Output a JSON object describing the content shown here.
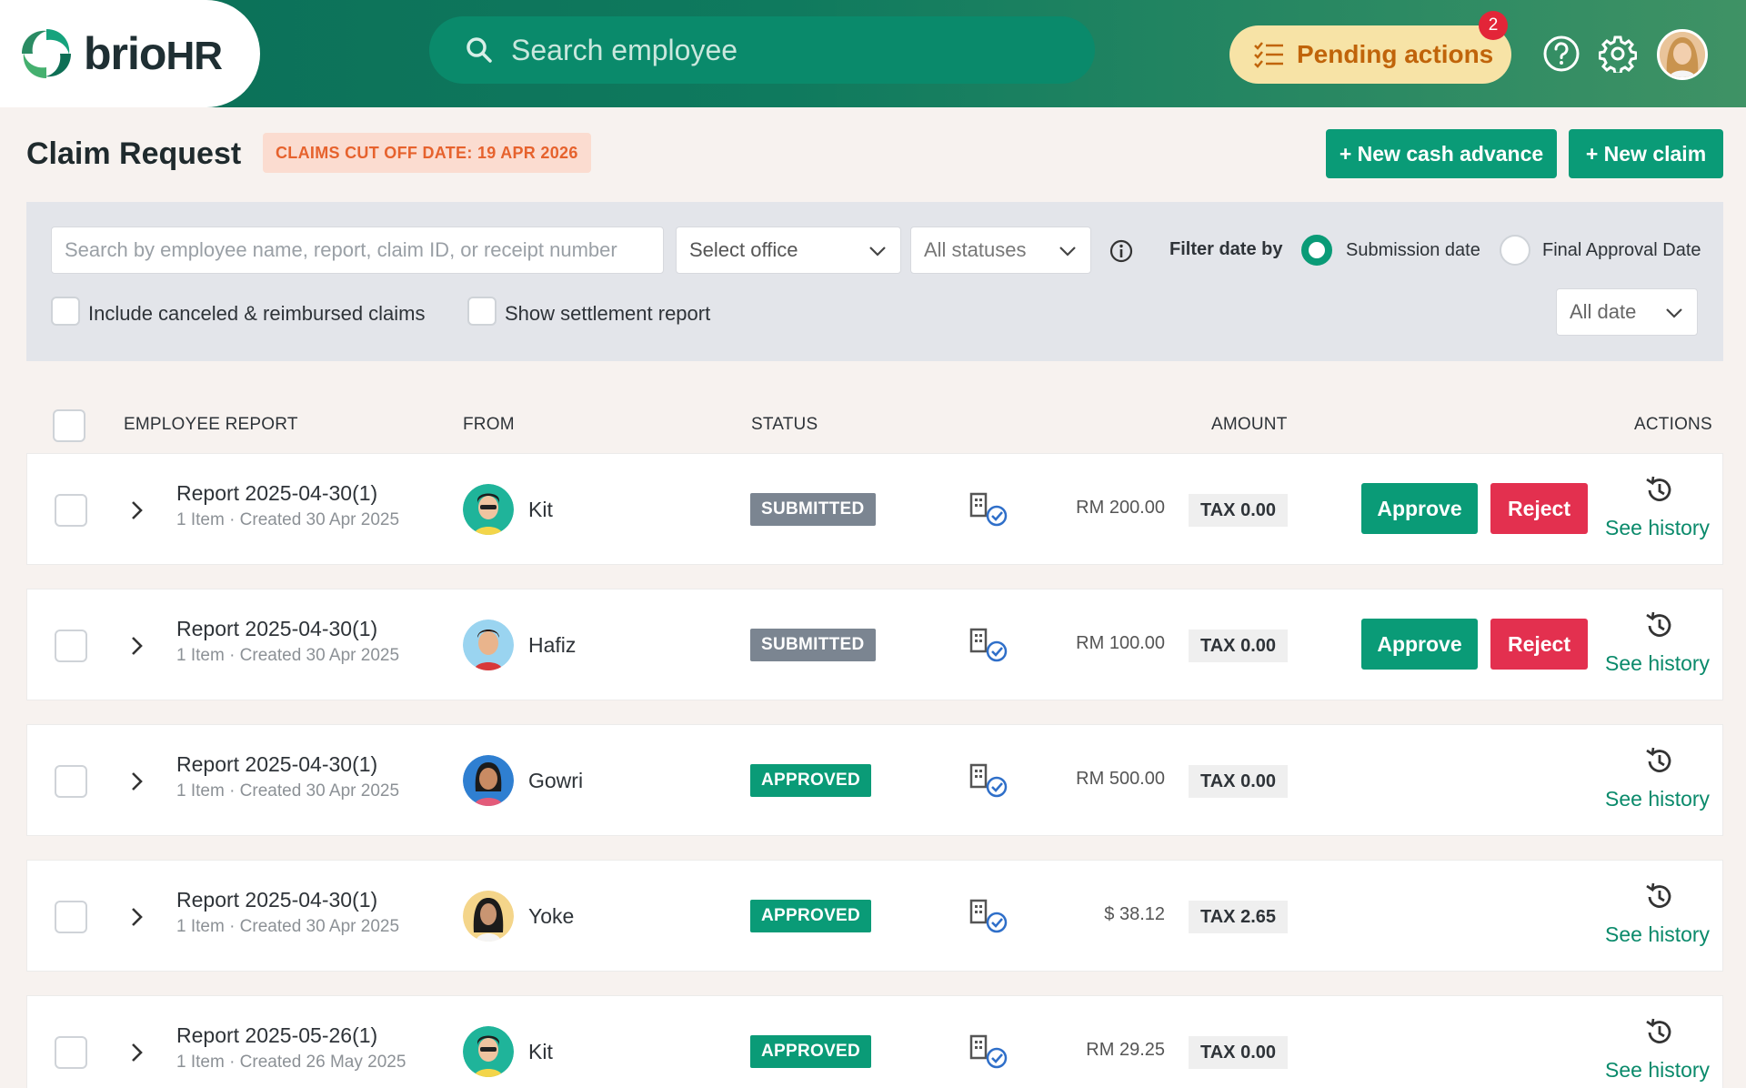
{
  "header": {
    "logo_text": "brio",
    "logo_suffix": "HR",
    "search_placeholder": "Search employee",
    "pending_label": "Pending actions",
    "pending_count": "2"
  },
  "page": {
    "title": "Claim Request",
    "cutoff_label": "CLAIMS CUT OFF DATE: 19 APR 2026",
    "new_cash_advance": "+ New cash advance",
    "new_claim": "+ New claim"
  },
  "filters": {
    "search_placeholder": "Search by employee name, report, claim ID, or receipt number",
    "office": "Select office",
    "status": "All statuses",
    "filter_date_by": "Filter date by",
    "submission_date": "Submission date",
    "final_approval_date": "Final Approval Date",
    "include_canceled": "Include canceled & reimbursed claims",
    "show_settlement": "Show settlement report",
    "date_range": "All date"
  },
  "table": {
    "headers": {
      "employee_report": "EMPLOYEE REPORT",
      "from": "FROM",
      "status": "STATUS",
      "amount": "AMOUNT",
      "actions": "ACTIONS"
    },
    "approve_label": "Approve",
    "reject_label": "Reject",
    "history_label": "See history",
    "rows": [
      {
        "report": "Report 2025-04-30(1)",
        "meta": "1 Item · Created 30 Apr 2025",
        "name": "Kit",
        "status": "SUBMITTED",
        "amount": "RM 200.00",
        "tax": "TAX 0.00"
      },
      {
        "report": "Report 2025-04-30(1)",
        "meta": "1 Item · Created 30 Apr 2025",
        "name": "Hafiz",
        "status": "SUBMITTED",
        "amount": "RM 100.00",
        "tax": "TAX 0.00"
      },
      {
        "report": "Report 2025-04-30(1)",
        "meta": "1 Item · Created 30 Apr 2025",
        "name": "Gowri",
        "status": "APPROVED",
        "amount": "RM 500.00",
        "tax": "TAX 0.00"
      },
      {
        "report": "Report 2025-04-30(1)",
        "meta": "1 Item · Created 30 Apr 2025",
        "name": "Yoke",
        "status": "APPROVED",
        "amount": "$ 38.12",
        "tax": "TAX 2.65"
      },
      {
        "report": "Report 2025-05-26(1)",
        "meta": "1 Item · Created 26 May 2025",
        "name": "Kit",
        "status": "APPROVED",
        "amount": "RM 29.25",
        "tax": "TAX 0.00"
      }
    ]
  },
  "colors": {
    "brand_green": "#0a9b77",
    "reject_red": "#e3304f",
    "submitted_gray": "#7b8591",
    "cutoff_orange": "#e6622d"
  }
}
